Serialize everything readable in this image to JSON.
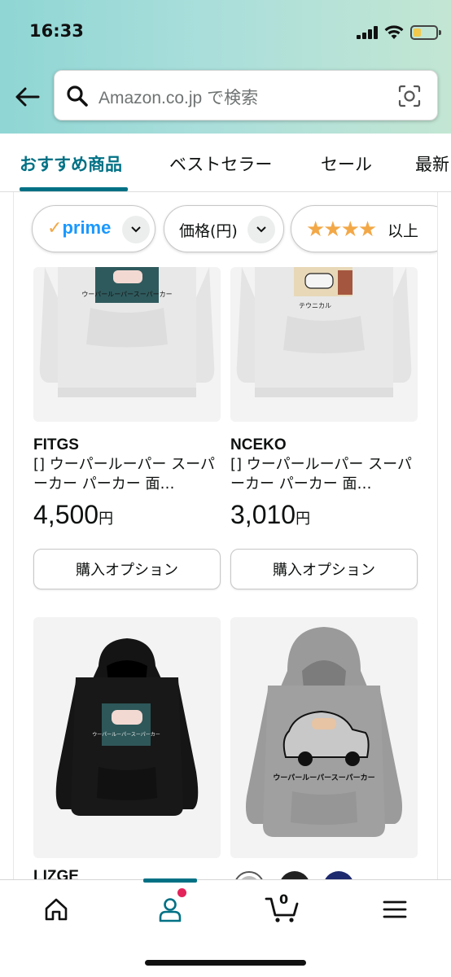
{
  "status_bar": {
    "time": "16:33"
  },
  "search": {
    "placeholder": "Amazon.co.jp で検索"
  },
  "tabs": [
    {
      "label": "おすすめ商品",
      "active": true
    },
    {
      "label": "ベストセラー",
      "active": false
    },
    {
      "label": "セール",
      "active": false
    },
    {
      "label": "最新",
      "active": false
    }
  ],
  "filters": {
    "prime": {
      "check": "✓",
      "word": "prime"
    },
    "price": "価格(円)",
    "rating": {
      "stars": "★★★★",
      "suffix": "以上"
    }
  },
  "products": [
    {
      "brand": "FITGS",
      "title": "[] ウーパールーパー スーパーカー パーカー 面…",
      "price": "4,500",
      "currency": "円",
      "button": "購入オプション",
      "hoodie_color": "#e6e6e6",
      "print_text": "ウーパールーパースーパーカー"
    },
    {
      "brand": "NCEKO",
      "title": "[] ウーパールーパー スーパーカー パーカー 面…",
      "price": "3,010",
      "currency": "円",
      "button": "購入オプション",
      "hoodie_color": "#e6e6e6",
      "print_text": "テウニカル"
    },
    {
      "brand": "LIZGE",
      "hoodie_color": "#141414",
      "print_text": "ウーパールーパースーパーカー"
    },
    {
      "hoodie_color": "#9a9a9a",
      "print_text": "ウーパールーパースーパーカー"
    }
  ],
  "swatches": [
    "#bdbdbd",
    "#222222",
    "#1e2a6e"
  ],
  "colors": {
    "accent": "#007185",
    "star": "#f3a847",
    "prime_blue": "#1a98ff",
    "notify": "#e3245a"
  },
  "bottom_nav": {
    "cart_count": "0",
    "items": [
      "home-icon",
      "account-icon",
      "cart-icon",
      "menu-icon"
    ]
  }
}
